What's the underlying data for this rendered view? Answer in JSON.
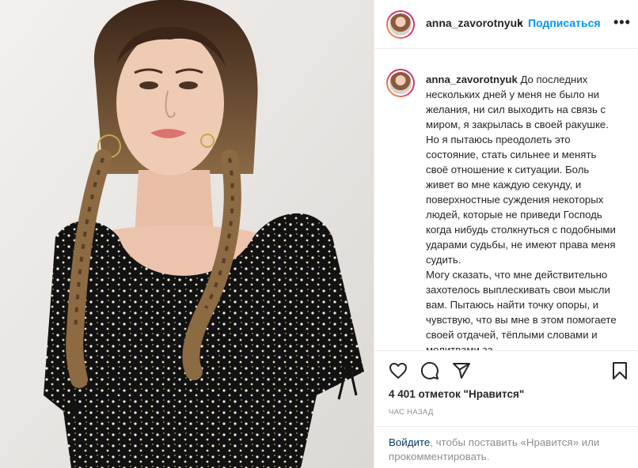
{
  "post": {
    "username": "anna_zavorotnyuk",
    "dot": "•",
    "follow_label": "Подписаться",
    "more_icon": "more-options-icon",
    "more_glyph": "•••"
  },
  "caption": {
    "username": "anna_zavorotnyuk",
    "paragraph1": "До последних нескольких дней у меня не было ни желания, ни сил выходить на связь с миром, я закрылась в своей ракушке. Но я пытаюсь преодолеть это состояние, стать сильнее и менять своё отношение к ситуации. Боль живет во мне каждую секунду, и поверхностные суждения некоторых людей, которые не приведи Господь когда нибудь столкнуться с подобными ударами судьбы, не имеют права меня судить.",
    "paragraph2": "Могу сказать, что мне действительно захотелось выплескивать свои мысли вам. Пытаюсь найти точку опоры, и чувствую, что вы мне в этом помогаете своей отдачей, тёплыми словами и молитвами за"
  },
  "actions": {
    "like_icon": "heart-icon",
    "comment_icon": "comment-icon",
    "share_icon": "share-icon",
    "save_icon": "bookmark-icon"
  },
  "likes_text": "4 401 отметок \"Нравится\"",
  "time_ago": "ЧАС НАЗАД",
  "login_prompt": {
    "link": "Войдите",
    "rest": ", чтобы поставить «Нравится» или прокомментировать."
  }
}
